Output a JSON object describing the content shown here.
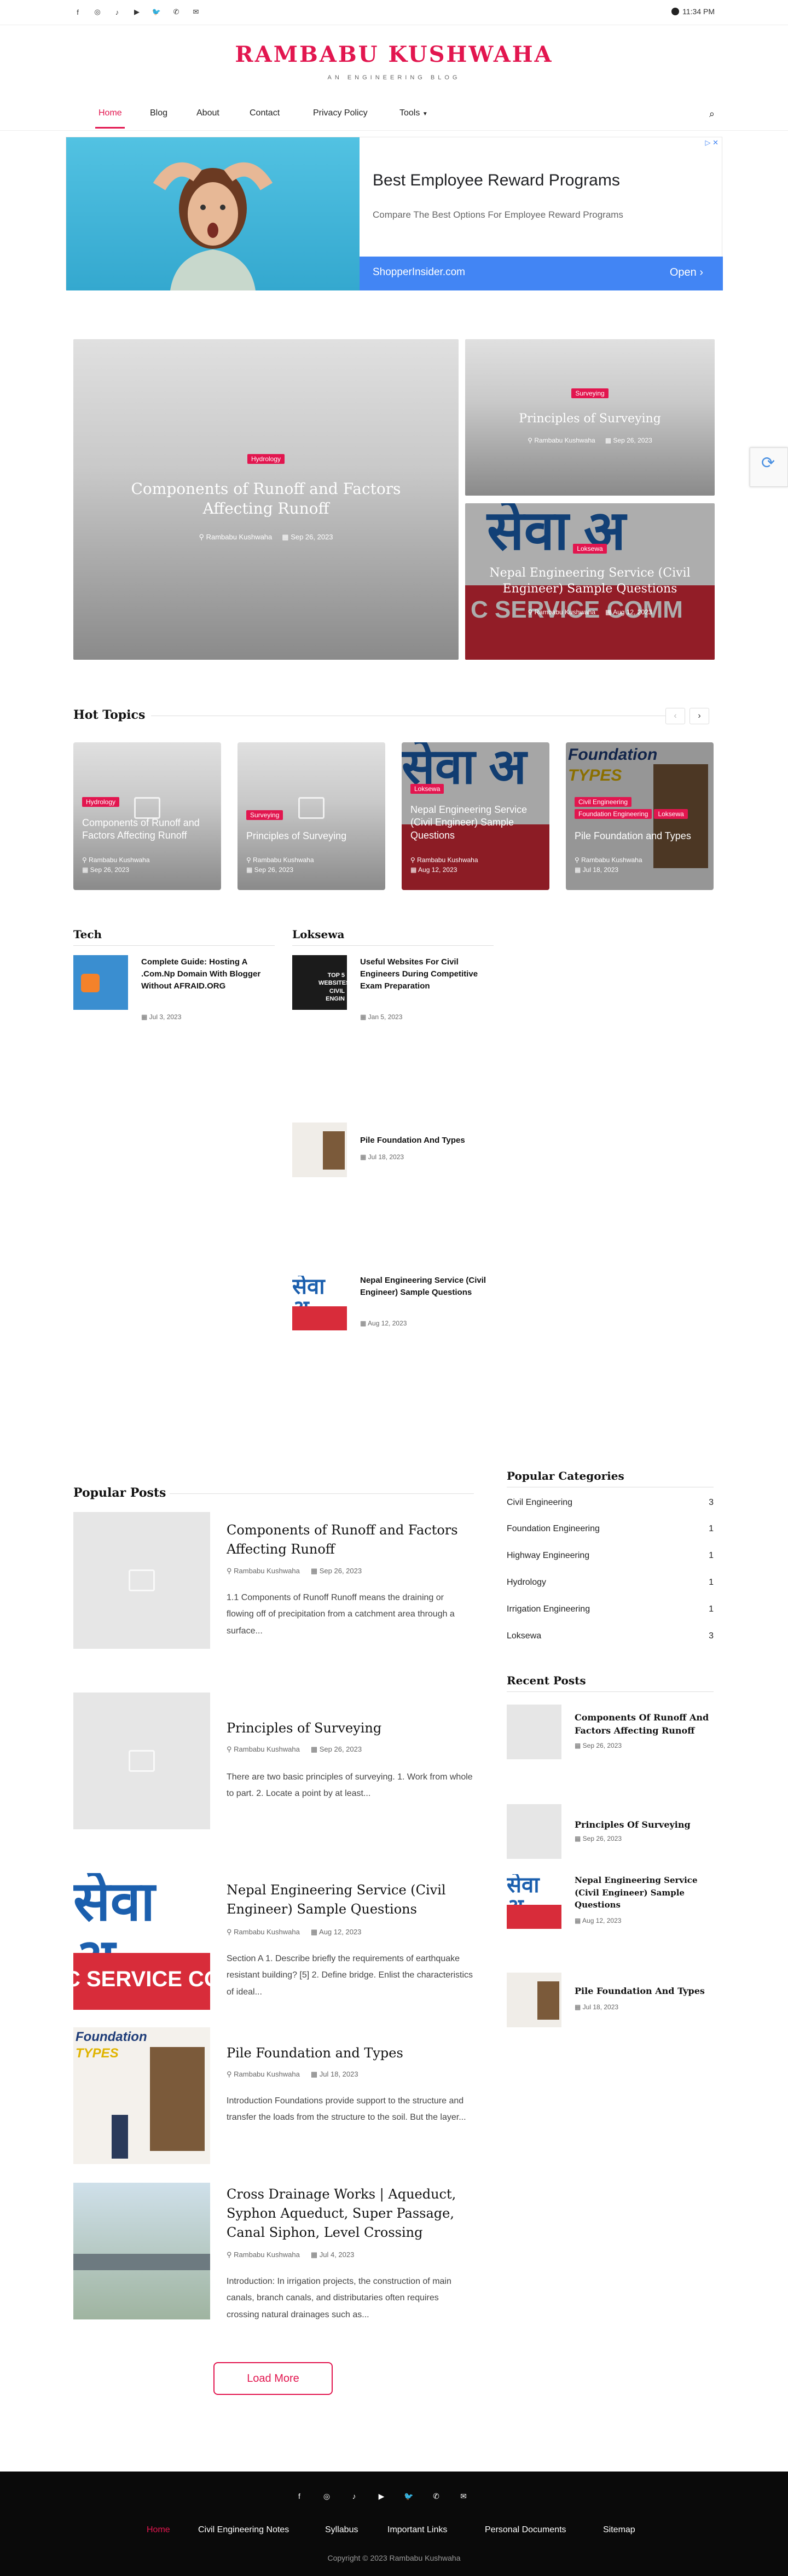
{
  "topbar": {
    "icons": [
      "facebook-icon",
      "instagram-icon",
      "tiktok-icon",
      "youtube-icon",
      "twitter-icon",
      "phone-icon",
      "mail-icon"
    ],
    "time": "11:34 PM"
  },
  "header": {
    "logo": "RAMBABU KUSHWAHA",
    "tagline": "AN ENGINEERING BLOG"
  },
  "nav": {
    "items": [
      "Home",
      "Blog",
      "About",
      "Contact",
      "Privacy Policy",
      "Tools"
    ]
  },
  "ad": {
    "headline": "Best Employee Reward Programs",
    "sub": "Compare The Best Options For Employee Reward Programs",
    "site": "ShopperInsider.com",
    "open": "Open"
  },
  "featured": [
    {
      "category": "Hydrology",
      "title": "Components of Runoff and Factors Affecting Runoff",
      "author": "Rambabu Kushwaha",
      "date": "Sep 26, 2023"
    },
    {
      "category": "Surveying",
      "title": "Principles of Surveying",
      "author": "Rambabu Kushwaha",
      "date": "Sep 26, 2023"
    },
    {
      "category": "Loksewa",
      "title": "Nepal Engineering Service (Civil Engineer) Sample Questions",
      "author": "Rambabu Kushwaha",
      "date": "Aug 12, 2023"
    }
  ],
  "hot": {
    "title": "Hot Topics",
    "cards": [
      {
        "cats": [
          "Hydrology"
        ],
        "title": "Components of Runoff and Factors Affecting Runoff",
        "author": "Rambabu Kushwaha",
        "date": "Sep 26, 2023"
      },
      {
        "cats": [
          "Surveying"
        ],
        "title": "Principles of Surveying",
        "author": "Rambabu Kushwaha",
        "date": "Sep 26, 2023"
      },
      {
        "cats": [
          "Loksewa"
        ],
        "title": "Nepal Engineering Service (Civil Engineer) Sample Questions",
        "author": "Rambabu Kushwaha",
        "date": "Aug 12, 2023"
      },
      {
        "cats": [
          "Civil Engineering",
          "Foundation Engineering",
          "Loksewa"
        ],
        "title": "Pile Foundation and Types",
        "author": "Rambabu Kushwaha",
        "date": "Jul 18, 2023"
      }
    ]
  },
  "tech": {
    "title": "Tech",
    "items": [
      {
        "title": "Complete Guide: Hosting A .Com.Np Domain With Blogger Without AFRAID.ORG",
        "date": "Jul 3, 2023"
      }
    ]
  },
  "loksewa": {
    "title": "Loksewa",
    "items": [
      {
        "title": "Useful Websites For Civil Engineers During Competitive Exam Preparation",
        "date": "Jan 5, 2023"
      },
      {
        "title": "Pile Foundation And Types",
        "date": "Jul 18, 2023"
      },
      {
        "title": "Nepal Engineering Service (Civil Engineer) Sample Questions",
        "date": "Aug 12, 2023"
      }
    ]
  },
  "popular": {
    "title": "Popular Posts",
    "posts": [
      {
        "title": "Components of Runoff and Factors Affecting Runoff",
        "author": "Rambabu Kushwaha",
        "date": "Sep 26, 2023",
        "excerpt": "1.1 Components of Runoff Runoff means the draining or flowing off of precipitation from a catchment area through a surface..."
      },
      {
        "title": "Principles of Surveying",
        "author": "Rambabu Kushwaha",
        "date": "Sep 26, 2023",
        "excerpt": "There are two basic principles of surveying. 1.  Work from whole to part. 2. Locate a point by at least..."
      },
      {
        "title": "Nepal Engineering Service (Civil Engineer) Sample Questions",
        "author": "Rambabu Kushwaha",
        "date": "Aug 12, 2023",
        "excerpt": "Section A 1. Describe briefly the requirements of earthquake resistant building? [5] 2. Define bridge. Enlist the characteristics of ideal..."
      },
      {
        "title": "Pile Foundation and Types",
        "author": "Rambabu Kushwaha",
        "date": "Jul 18, 2023",
        "excerpt": "Introduction Foundations provide support to the structure and transfer the loads from the structure to the soil. But the layer..."
      },
      {
        "title": "Cross Drainage Works | Aqueduct, Syphon Aqueduct, Super Passage, Canal Siphon, Level Crossing",
        "author": "Rambabu Kushwaha",
        "date": "Jul 4, 2023",
        "excerpt": "Introduction: In irrigation projects, the construction of main canals, branch canals, and distributaries often requires crossing natural drainages such as..."
      }
    ],
    "load_more": "Load More"
  },
  "categories": {
    "title": "Popular Categories",
    "items": [
      {
        "name": "Civil Engineering",
        "count": "3"
      },
      {
        "name": "Foundation Engineering",
        "count": "1"
      },
      {
        "name": "Highway Engineering",
        "count": "1"
      },
      {
        "name": "Hydrology",
        "count": "1"
      },
      {
        "name": "Irrigation Engineering",
        "count": "1"
      },
      {
        "name": "Loksewa",
        "count": "3"
      }
    ]
  },
  "recent": {
    "title": "Recent Posts",
    "items": [
      {
        "title": "Components Of Runoff And Factors Affecting Runoff",
        "date": "Sep 26, 2023"
      },
      {
        "title": "Principles Of Surveying",
        "date": "Sep 26, 2023"
      },
      {
        "title": "Nepal Engineering Service (Civil Engineer) Sample Questions",
        "date": "Aug 12, 2023"
      },
      {
        "title": "Pile Foundation And Types",
        "date": "Jul 18, 2023"
      }
    ]
  },
  "footer": {
    "links": [
      "Home",
      "Civil Engineering Notes",
      "Syllabus",
      "Important Links",
      "Personal Documents",
      "Sitemap"
    ],
    "copyright": "Copyright © 2023 Rambabu Kushwaha"
  },
  "labels": {
    "seva": "सेवा अ",
    "service": "C SERVICE COMM",
    "foundation": "Foundation",
    "types": "TYPES",
    "top5": "TOP 5",
    "websites": "WEBSITES",
    "civil": "CIVIL ENGIN"
  },
  "colors": {
    "accent": "#e2164f",
    "footer": "#0a0a0a",
    "ad_bar": "#4285f4"
  }
}
